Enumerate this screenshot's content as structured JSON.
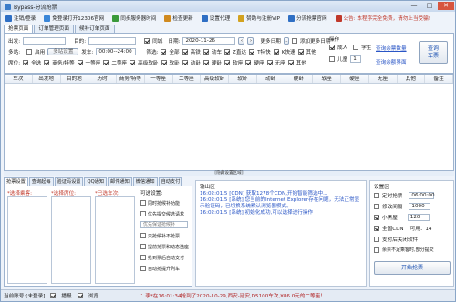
{
  "window": {
    "title": "Bypass-分流抢票",
    "min": "—",
    "max": "□",
    "close": "✕"
  },
  "toolbar": [
    {
      "label": "注销/登录",
      "icon": "logout-icon",
      "color": "#2f6fc4"
    },
    {
      "label": "免登录打开12306官网",
      "icon": "browser-icon",
      "color": "#3a86d8"
    },
    {
      "label": "同步服务器时间",
      "icon": "sync-icon",
      "color": "#3a9a3a"
    },
    {
      "label": "检查更新",
      "icon": "update-icon",
      "color": "#d08a1f"
    },
    {
      "label": "设置代理",
      "icon": "gear-icon",
      "color": "#2f6fc4"
    },
    {
      "label": "赞助与注册VIP",
      "icon": "vip-icon",
      "color": "#d3a21f"
    },
    {
      "label": "分流抢票官网",
      "icon": "home-icon",
      "color": "#2f6fc4"
    },
    {
      "label": "公告: 本程序完全免费，请勿上当受骗!",
      "icon": "notice-icon",
      "color": "#c0392b"
    }
  ],
  "tabs": [
    "抢票页面",
    "订单管理页面",
    "候补订单页面"
  ],
  "form": {
    "from_label": "出发:",
    "to_label": "目的:",
    "same_city": "同城",
    "date_label": "日期:",
    "date_value": "2020-11-26",
    "more_dates": "更多日期",
    "add_more_dates": "添加更多日期",
    "multistation_label": "多站:",
    "enable_label": "启用",
    "add_station": "多站设置",
    "depart_time_label": "发车:",
    "depart_time_value": "00:00--24:00",
    "filter_label": "筛选:",
    "all_label": "全部",
    "train_types": [
      "高铁",
      "动车",
      "Z直达",
      "T特快",
      "K快速",
      "其他"
    ],
    "seat_label": "席位:",
    "seat_all": "全选",
    "seats": [
      "商务/特等",
      "一等座",
      "二等座",
      "高级软卧",
      "软卧",
      "动卧",
      "硬卧",
      "软座",
      "硬座",
      "无座",
      "其他"
    ],
    "passenger_label": "操作",
    "passengers": [
      "成人",
      "学生",
      "儿童"
    ],
    "count_value": "1",
    "links": [
      "查询余票数量",
      "查询余额界面"
    ],
    "query_button": "查询\n车票"
  },
  "grid_headers": [
    "车次",
    "出发地",
    "目的地",
    "历时",
    "商务/特等",
    "一等座",
    "二等座",
    "高级软卧",
    "软卧",
    "动卧",
    "硬卧",
    "软座",
    "硬座",
    "无座",
    "其他",
    "备注"
  ],
  "hide_bar": "[隐藏设置区域]",
  "bottom_tabs": [
    "抢票设置",
    "查询起每",
    "验证码设置",
    "QQ通知",
    "邮件通知",
    "微信通知",
    "自动支付"
  ],
  "bottom": {
    "passengers_col": "*选择乘客:",
    "seats_col": "*选择席位:",
    "trains_col": "*已选车次:",
    "options_title": "可选设置:",
    "options": [
      "同时抢候补功能",
      "优先提交候选请求",
      "优先保证抢候补",
      "只抢候补不抢票",
      "提前抢票和动态选座",
      "抢到票后自动支付",
      "自动抢提升列车"
    ],
    "select_value": "优先保证抢候补"
  },
  "log": {
    "header": "输出区",
    "lines": [
      {
        "time": "16:02:01.5",
        "text": "[CDN] 获取1278个CDN,开始智能筛选中..."
      },
      {
        "time": "16:02:01.5",
        "text": "[系统] 您当前的Internet Explorer存在问题，无法正常显示验证码，已切换系统默认浏览器模式。"
      },
      {
        "time": "16:02:01.5",
        "text": "[系统] 初始化成功,可以选择进行操作"
      }
    ]
  },
  "settings": {
    "title": "设置区",
    "timed_label": "定时抢票",
    "timed_value": "06:00:00",
    "edit_interval": "修改间隔",
    "edit_value": "1000",
    "small_black": "小黑屋",
    "small_black_value": "120",
    "all_cdn": "全国CDN",
    "cdn_count": "可用：14",
    "opt1": "支付后关闭软件",
    "opt2": "余票不足乘客时,部分提交",
    "start_button": "开始抢票"
  },
  "status": {
    "account": "当前账号:[未登录]",
    "sound": "播报",
    "browser": "浏览",
    "marquee": "：李*在16:01:34抢到了2020-10-29,西安-延安,D5100车次,¥86.0元的二等座！"
  }
}
